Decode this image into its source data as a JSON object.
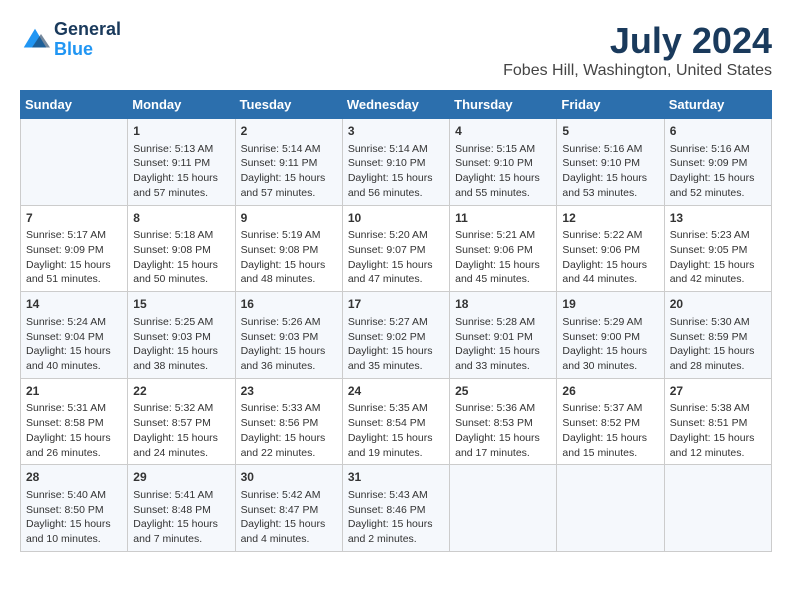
{
  "header": {
    "logo_line1": "General",
    "logo_line2": "Blue",
    "title": "July 2024",
    "subtitle": "Fobes Hill, Washington, United States"
  },
  "calendar": {
    "days_of_week": [
      "Sunday",
      "Monday",
      "Tuesday",
      "Wednesday",
      "Thursday",
      "Friday",
      "Saturday"
    ],
    "weeks": [
      [
        {
          "day": "",
          "info": ""
        },
        {
          "day": "1",
          "info": "Sunrise: 5:13 AM\nSunset: 9:11 PM\nDaylight: 15 hours\nand 57 minutes."
        },
        {
          "day": "2",
          "info": "Sunrise: 5:14 AM\nSunset: 9:11 PM\nDaylight: 15 hours\nand 57 minutes."
        },
        {
          "day": "3",
          "info": "Sunrise: 5:14 AM\nSunset: 9:10 PM\nDaylight: 15 hours\nand 56 minutes."
        },
        {
          "day": "4",
          "info": "Sunrise: 5:15 AM\nSunset: 9:10 PM\nDaylight: 15 hours\nand 55 minutes."
        },
        {
          "day": "5",
          "info": "Sunrise: 5:16 AM\nSunset: 9:10 PM\nDaylight: 15 hours\nand 53 minutes."
        },
        {
          "day": "6",
          "info": "Sunrise: 5:16 AM\nSunset: 9:09 PM\nDaylight: 15 hours\nand 52 minutes."
        }
      ],
      [
        {
          "day": "7",
          "info": "Sunrise: 5:17 AM\nSunset: 9:09 PM\nDaylight: 15 hours\nand 51 minutes."
        },
        {
          "day": "8",
          "info": "Sunrise: 5:18 AM\nSunset: 9:08 PM\nDaylight: 15 hours\nand 50 minutes."
        },
        {
          "day": "9",
          "info": "Sunrise: 5:19 AM\nSunset: 9:08 PM\nDaylight: 15 hours\nand 48 minutes."
        },
        {
          "day": "10",
          "info": "Sunrise: 5:20 AM\nSunset: 9:07 PM\nDaylight: 15 hours\nand 47 minutes."
        },
        {
          "day": "11",
          "info": "Sunrise: 5:21 AM\nSunset: 9:06 PM\nDaylight: 15 hours\nand 45 minutes."
        },
        {
          "day": "12",
          "info": "Sunrise: 5:22 AM\nSunset: 9:06 PM\nDaylight: 15 hours\nand 44 minutes."
        },
        {
          "day": "13",
          "info": "Sunrise: 5:23 AM\nSunset: 9:05 PM\nDaylight: 15 hours\nand 42 minutes."
        }
      ],
      [
        {
          "day": "14",
          "info": "Sunrise: 5:24 AM\nSunset: 9:04 PM\nDaylight: 15 hours\nand 40 minutes."
        },
        {
          "day": "15",
          "info": "Sunrise: 5:25 AM\nSunset: 9:03 PM\nDaylight: 15 hours\nand 38 minutes."
        },
        {
          "day": "16",
          "info": "Sunrise: 5:26 AM\nSunset: 9:03 PM\nDaylight: 15 hours\nand 36 minutes."
        },
        {
          "day": "17",
          "info": "Sunrise: 5:27 AM\nSunset: 9:02 PM\nDaylight: 15 hours\nand 35 minutes."
        },
        {
          "day": "18",
          "info": "Sunrise: 5:28 AM\nSunset: 9:01 PM\nDaylight: 15 hours\nand 33 minutes."
        },
        {
          "day": "19",
          "info": "Sunrise: 5:29 AM\nSunset: 9:00 PM\nDaylight: 15 hours\nand 30 minutes."
        },
        {
          "day": "20",
          "info": "Sunrise: 5:30 AM\nSunset: 8:59 PM\nDaylight: 15 hours\nand 28 minutes."
        }
      ],
      [
        {
          "day": "21",
          "info": "Sunrise: 5:31 AM\nSunset: 8:58 PM\nDaylight: 15 hours\nand 26 minutes."
        },
        {
          "day": "22",
          "info": "Sunrise: 5:32 AM\nSunset: 8:57 PM\nDaylight: 15 hours\nand 24 minutes."
        },
        {
          "day": "23",
          "info": "Sunrise: 5:33 AM\nSunset: 8:56 PM\nDaylight: 15 hours\nand 22 minutes."
        },
        {
          "day": "24",
          "info": "Sunrise: 5:35 AM\nSunset: 8:54 PM\nDaylight: 15 hours\nand 19 minutes."
        },
        {
          "day": "25",
          "info": "Sunrise: 5:36 AM\nSunset: 8:53 PM\nDaylight: 15 hours\nand 17 minutes."
        },
        {
          "day": "26",
          "info": "Sunrise: 5:37 AM\nSunset: 8:52 PM\nDaylight: 15 hours\nand 15 minutes."
        },
        {
          "day": "27",
          "info": "Sunrise: 5:38 AM\nSunset: 8:51 PM\nDaylight: 15 hours\nand 12 minutes."
        }
      ],
      [
        {
          "day": "28",
          "info": "Sunrise: 5:40 AM\nSunset: 8:50 PM\nDaylight: 15 hours\nand 10 minutes."
        },
        {
          "day": "29",
          "info": "Sunrise: 5:41 AM\nSunset: 8:48 PM\nDaylight: 15 hours\nand 7 minutes."
        },
        {
          "day": "30",
          "info": "Sunrise: 5:42 AM\nSunset: 8:47 PM\nDaylight: 15 hours\nand 4 minutes."
        },
        {
          "day": "31",
          "info": "Sunrise: 5:43 AM\nSunset: 8:46 PM\nDaylight: 15 hours\nand 2 minutes."
        },
        {
          "day": "",
          "info": ""
        },
        {
          "day": "",
          "info": ""
        },
        {
          "day": "",
          "info": ""
        }
      ]
    ]
  }
}
